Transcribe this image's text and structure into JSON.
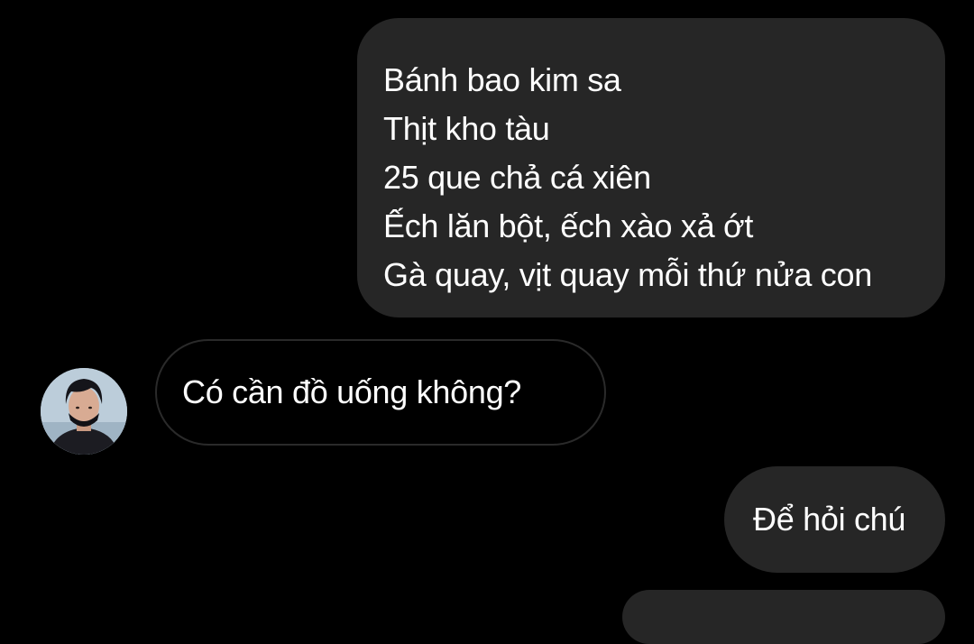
{
  "conversation": {
    "messages": [
      {
        "direction": "outgoing",
        "lines": [
          "Bánh bao kim sa",
          "Thịt kho tàu",
          "25 que chả cá xiên",
          "Ếch lăn bột, ếch xào xả ớt",
          "Gà quay, vịt quay mỗi thứ nửa con"
        ]
      },
      {
        "direction": "incoming",
        "text": "Có cần đồ uống không?",
        "avatar": "user-profile-photo"
      },
      {
        "direction": "outgoing",
        "text": "Để hỏi chú"
      },
      {
        "direction": "outgoing",
        "text": ""
      }
    ]
  },
  "colors": {
    "background": "#000000",
    "outgoing_bubble": "#262626",
    "incoming_bubble_border": "#2a2a2a",
    "text": "#ffffff"
  }
}
